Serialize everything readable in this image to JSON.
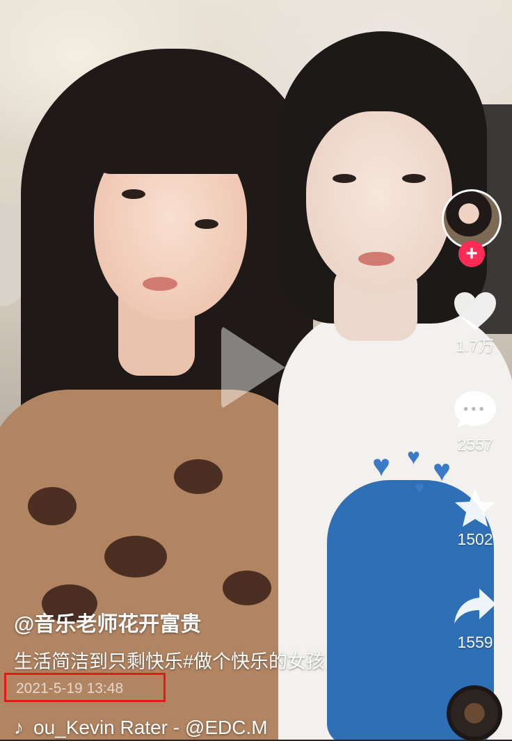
{
  "video": {
    "play_icon": "play-icon"
  },
  "rail": {
    "like_count": "1.7万",
    "comment_count": "2557",
    "favorite_count": "1502",
    "share_count": "1559",
    "follow_symbol": "+",
    "icons": [
      "heart-icon",
      "comment-icon",
      "star-icon",
      "share-icon",
      "music-disc-icon"
    ]
  },
  "caption": {
    "author": "@音乐老师花开富贵",
    "description": "生活简洁到只剩快乐#做个快乐的女孩",
    "date": "2021-5-19 13:48",
    "music": "ou_Kevin Rater - @EDC.M"
  },
  "colors": {
    "follow_badge": "#fe2c55",
    "highlight_box": "#e5191a"
  }
}
